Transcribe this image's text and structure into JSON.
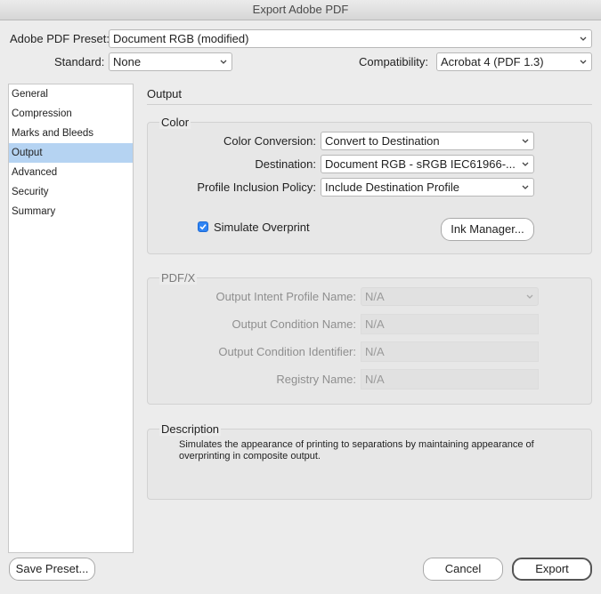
{
  "window": {
    "title": "Export Adobe PDF"
  },
  "preset": {
    "label": "Adobe PDF Preset:",
    "value": "Document RGB (modified)"
  },
  "standard": {
    "label": "Standard:",
    "value": "None"
  },
  "compatibility": {
    "label": "Compatibility:",
    "value": "Acrobat 4 (PDF 1.3)"
  },
  "sidebar": {
    "items": [
      {
        "label": "General"
      },
      {
        "label": "Compression"
      },
      {
        "label": "Marks and Bleeds"
      },
      {
        "label": "Output"
      },
      {
        "label": "Advanced"
      },
      {
        "label": "Security"
      },
      {
        "label": "Summary"
      }
    ],
    "selected": "Output"
  },
  "section": {
    "title": "Output"
  },
  "color": {
    "group_title": "Color",
    "conversion": {
      "label": "Color Conversion:",
      "value": "Convert to Destination"
    },
    "destination": {
      "label": "Destination:",
      "value": "Document RGB - sRGB IEC61966-..."
    },
    "profile_policy": {
      "label": "Profile Inclusion Policy:",
      "value": "Include Destination Profile"
    },
    "simulate_overprint": {
      "label": "Simulate Overprint",
      "checked": true
    },
    "ink_manager": "Ink Manager..."
  },
  "pdfx": {
    "group_title": "PDF/X",
    "output_intent": {
      "label": "Output Intent Profile Name:",
      "value": "N/A"
    },
    "condition_name": {
      "label": "Output Condition Name:",
      "value": "N/A"
    },
    "condition_identifier": {
      "label": "Output Condition Identifier:",
      "value": "N/A"
    },
    "registry_name": {
      "label": "Registry Name:",
      "value": "N/A"
    }
  },
  "description": {
    "group_title": "Description",
    "text_line1": "Simulates the appearance of printing to separations by maintaining appearance of",
    "text_line2": "overprinting in composite output."
  },
  "buttons": {
    "save_preset": "Save Preset...",
    "cancel": "Cancel",
    "export": "Export"
  }
}
